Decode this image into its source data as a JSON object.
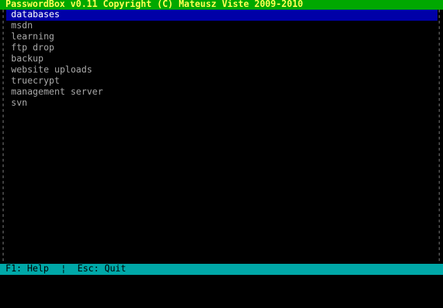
{
  "title_bar": {
    "text": "PasswordBox v0.11 Copyright (C) Mateusz Viste 2009-2010"
  },
  "list": {
    "selected_index": 0,
    "items": [
      {
        "label": "databases"
      },
      {
        "label": "msdn"
      },
      {
        "label": "learning"
      },
      {
        "label": "ftp drop"
      },
      {
        "label": "backup"
      },
      {
        "label": "website uploads"
      },
      {
        "label": "truecrypt"
      },
      {
        "label": "management server"
      },
      {
        "label": "svn"
      }
    ]
  },
  "status_bar": {
    "help_hint": "F1: Help",
    "separator": "¦",
    "quit_hint": "Esc: Quit"
  },
  "colors": {
    "title_background": "#00a800",
    "title_text": "#ffff54",
    "selection_background": "#0000a8",
    "selection_text": "#ffffff",
    "item_text": "#a8a8a8",
    "status_background": "#00a8a8",
    "status_text": "#000000"
  }
}
